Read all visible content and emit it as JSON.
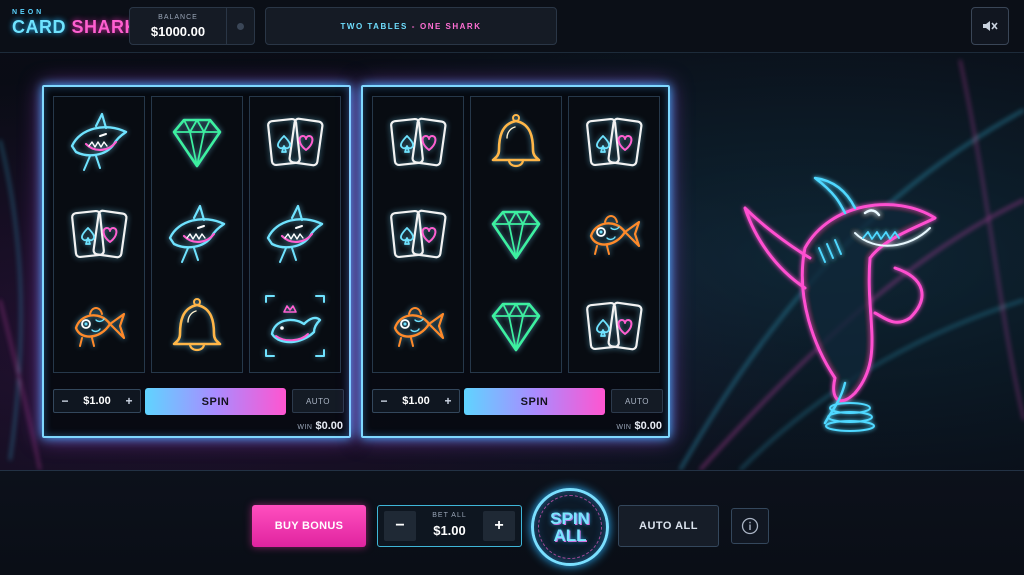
{
  "header": {
    "logo_small": "NEON",
    "logo_word1": "CARD",
    "logo_word2": "SHARK",
    "balance_label": "BALANCE",
    "balance_value": "$1000.00",
    "tagline_part1": "TWO TABLES",
    "tagline_sep": "-",
    "tagline_part2": "ONE SHARK",
    "sound_icon": "sound-off-icon"
  },
  "tables": [
    {
      "reels": [
        [
          "shark",
          "cards",
          "goldfish"
        ],
        [
          "diamond",
          "shark",
          "bell"
        ],
        [
          "cards",
          "shark",
          "whale"
        ]
      ],
      "bet": "$1.00",
      "spin_label": "SPIN",
      "auto_label": "AUTO",
      "win_label": "WIN",
      "win_value": "$0.00"
    },
    {
      "reels": [
        [
          "cards",
          "cards",
          "goldfish"
        ],
        [
          "bell",
          "diamond",
          "diamond"
        ],
        [
          "cards",
          "goldfish",
          "cards"
        ]
      ],
      "bet": "$1.00",
      "spin_label": "SPIN",
      "auto_label": "AUTO",
      "win_label": "WIN",
      "win_value": "$0.00"
    }
  ],
  "controls": {
    "minus": "−",
    "plus": "+"
  },
  "footer": {
    "buy_bonus": "BUY BONUS",
    "bet_all_label": "BET ALL",
    "bet_all_value": "$1.00",
    "minus": "−",
    "plus": "+",
    "spin_all_1": "SPIN",
    "spin_all_2": "ALL",
    "auto_all": "AUTO ALL",
    "info_icon": "info-icon"
  },
  "colors": {
    "cyan": "#6fe3ff",
    "pink": "#ff5fd0",
    "green": "#3df0a0",
    "gold": "#ffb648",
    "orange": "#ff8a2a"
  }
}
